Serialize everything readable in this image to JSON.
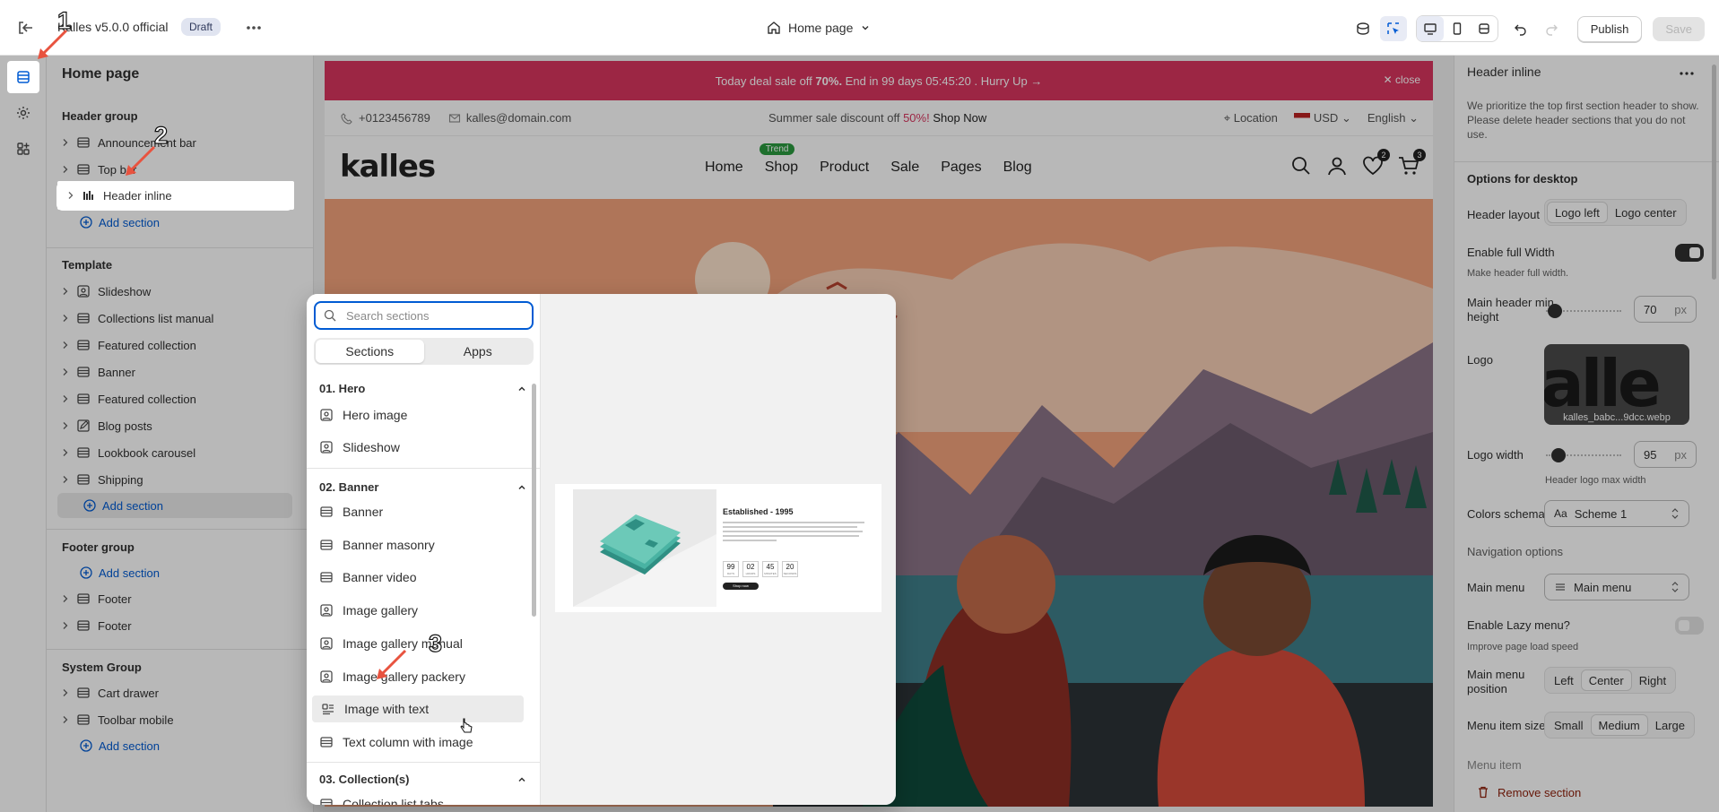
{
  "topbar": {
    "title": "Kalles v5.0.0 official",
    "badge": "Draft",
    "page_selector": "Home page",
    "publish_label": "Publish",
    "save_label": "Save"
  },
  "sidebar": {
    "title": "Home page",
    "header_group": {
      "title": "Header group",
      "items": [
        "Announcement bar",
        "Top bar",
        "Header inline"
      ],
      "add_label": "Add section"
    },
    "template": {
      "title": "Template",
      "items": [
        "Slideshow",
        "Collections list manual",
        "Featured collection",
        "Banner",
        "Featured collection",
        "Blog posts",
        "Lookbook carousel",
        "Shipping"
      ],
      "add_label": "Add section"
    },
    "footer_group": {
      "title": "Footer group",
      "add_label": "Add section",
      "items": [
        "Footer",
        "Footer"
      ]
    },
    "system_group": {
      "title": "System Group",
      "items": [
        "Cart drawer",
        "Toolbar mobile"
      ],
      "add_label": "Add section"
    }
  },
  "preview": {
    "promo_pre": "Today deal sale off ",
    "promo_bold": "70%.",
    "promo_post": " End in 99 days 05:45:20 .  Hurry Up →",
    "promo_close": "close",
    "phone": "+0123456789",
    "email": "kalles@domain.com",
    "summer_pre": "Summer sale discount off ",
    "summer_pct": "50%!",
    "summer_link": " Shop Now",
    "location": "Location",
    "currency": "USD",
    "language": "English",
    "logo": "kalles",
    "menu": [
      "Home",
      "Shop",
      "Product",
      "Sale",
      "Pages",
      "Blog"
    ],
    "trend_badge": "Trend",
    "wishlist_count": "2",
    "cart_count": "3"
  },
  "picker": {
    "search_placeholder": "Search sections",
    "tabs": [
      "Sections",
      "Apps"
    ],
    "categories": [
      {
        "title": "01. Hero",
        "items": [
          "Hero image",
          "Slideshow"
        ]
      },
      {
        "title": "02. Banner",
        "items": [
          "Banner",
          "Banner masonry",
          "Banner video",
          "Image gallery",
          "Image gallery manual",
          "Image gallery packery",
          "Image with text",
          "Text column with image"
        ]
      },
      {
        "title": "03. Collection(s)",
        "items": [
          "Collection list tabs"
        ]
      }
    ],
    "preview": {
      "title": "Established - 1995",
      "timer": [
        {
          "value": "99",
          "unit": "DAYS"
        },
        {
          "value": "02",
          "unit": "HOURS"
        },
        {
          "value": "45",
          "unit": "MINUTES"
        },
        {
          "value": "20",
          "unit": "SECONDS"
        }
      ],
      "button": "Shop now"
    }
  },
  "rpanel": {
    "title": "Header inline",
    "note": "We prioritize the top first section header to show. Please delete header sections that you do not use.",
    "desktop_heading": "Options for desktop",
    "header_layout_label": "Header layout",
    "header_layout_options": [
      "Logo left",
      "Logo center"
    ],
    "full_width_label": "Enable full Width",
    "full_width_help": "Make header full width.",
    "min_height_label": "Main header min height",
    "min_height_value": "70",
    "min_height_unit": "px",
    "logo_label": "Logo",
    "logo_file": "kalles_babc...9dcc.webp",
    "logo_preview_text": "alle",
    "logo_width_label": "Logo width",
    "logo_width_value": "95",
    "logo_width_unit": "px",
    "logo_width_help": "Header logo max width",
    "colors_label": "Colors schema",
    "colors_value": "Scheme 1",
    "nav_heading": "Navigation options",
    "main_menu_label": "Main menu",
    "main_menu_value": "Main menu",
    "lazy_label": "Enable Lazy menu?",
    "lazy_help": "Improve page load speed",
    "menu_position_label": "Main menu position",
    "menu_position_options": [
      "Left",
      "Center",
      "Right"
    ],
    "menu_size_label": "Menu item size",
    "menu_size_options": [
      "Small",
      "Medium",
      "Large"
    ],
    "menu_item_label": "Menu item",
    "remove_label": "Remove section"
  },
  "annotations": [
    "1",
    "2",
    "3"
  ],
  "colors": {
    "promo": "#d8355f",
    "accent": "#005bd3",
    "trend": "#2a9a3f",
    "annotation_arrow": "#e8533f"
  }
}
